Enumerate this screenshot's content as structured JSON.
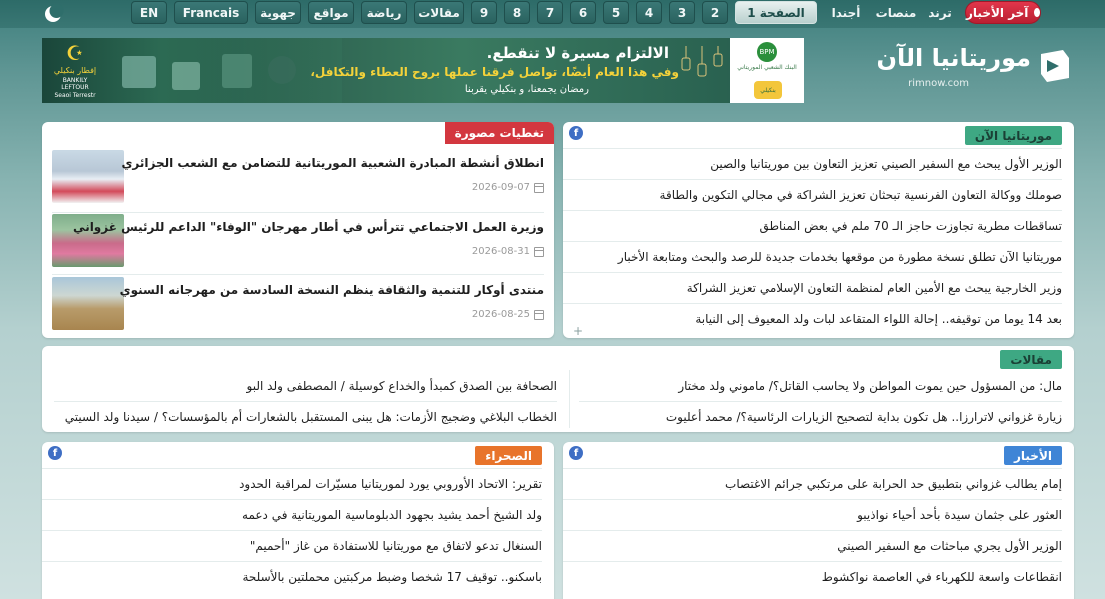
{
  "topnav": {
    "latest_label": "آخر الأخبار",
    "items": [
      "ترند",
      "منصات",
      "أجندا",
      "الصفحة 1",
      "2",
      "3",
      "4",
      "5",
      "6",
      "7",
      "8",
      "9",
      "مقالات",
      "رياضة",
      "مواقع",
      "جهوية",
      "Francais",
      "EN"
    ],
    "active_index": 3,
    "moon_icon": "moon-icon"
  },
  "header": {
    "logo_title": "موريتانيا الآن",
    "logo_url": "rimnow.com"
  },
  "banner": {
    "headline": "الالتزام مسيرة لا تنقطع.",
    "subline": "وفي هذا العام أيضًا، تواصل فرقنا عملها بروح العطاء والتكافل،",
    "tagline": "رمضان يجمعنا، و بنكيلي يقربنا",
    "brand_line1": "إفطار بنكيلي",
    "brand_line2": "BANKILY LEFTOUR",
    "brand_line3": "Seaoi Terrestr",
    "sponsor_text": "البنك الشعبي الموريتاني",
    "sponsor_badge": "بنكيلي"
  },
  "photo_coverage": {
    "tag": "تغطيات مصورة",
    "items": [
      {
        "title": "انطلاق أنشطة المبادرة الشعبية الموريتانية للتضامن مع الشعب الجزائري",
        "date": "2026-09-07"
      },
      {
        "title": "وزيرة العمل الاجتماعي تترأس في أطار مهرجان \"الوفاء\" الداعم للرئيس غزواني",
        "date": "2026-08-31"
      },
      {
        "title": "منتدى أوكار للتنمية والثقافة ينظم النسخة السادسة من مهرجانه السنوي",
        "date": "2026-08-25"
      }
    ]
  },
  "mauritania_now": {
    "tag": "موريتانيا الآن",
    "items": [
      "الوزير الأول يبحث مع السفير الصيني تعزيز التعاون بين موريتانيا والصين",
      "صوملك ووكالة التعاون الفرنسية تبحثان تعزيز الشراكة في مجالي التكوين والطاقة",
      "تساقطات مطرية تجاوزت حاجز الـ 70 ملم في بعض المناطق",
      "موريتانيا الآن تطلق نسخة مطورة من موقعها بخدمات جديدة للرصد والبحث ومتابعة الأخبار",
      "وزير الخارجية يبحث مع الأمين العام لمنظمة التعاون الإسلامي تعزيز الشراكة",
      "بعد 14 يوما من توقيفه.. إحالة اللواء المتقاعد لبات ولد المعيوف إلى النيابة"
    ]
  },
  "articles": {
    "tag": "مقالات",
    "items": [
      "مال: من المسؤول حين يموت المواطن ولا يحاسب القاتل؟/ ماموني ولد مختار",
      "الصحافة بين الصدق كمبدأ والخداع كوسيلة / المصطفى ولد البو",
      "زيارة غزواني لاترارزا.. هل تكون بداية لتصحيح الزيارات الرئاسية؟/ محمد أعليوت",
      "الخطاب البلاغي وضجيج الأزمات: هل يبنى المستقبل بالشعارات أم بالمؤسسات؟ / سيدنا ولد السيتي"
    ]
  },
  "sahara": {
    "tag": "الصحراء",
    "items": [
      "تقرير: الاتحاد الأوروبي يورد لموريتانيا مسيّرات لمراقبة الحدود",
      "ولد الشيخ أحمد يشيد بجهود الدبلوماسية الموريتانية في دعمه",
      "السنغال تدعو لاتفاق مع موريتانيا للاستفادة من غاز \"أحميم\"",
      "باسكنو.. توقيف 17 شخصا وضبط مركبتين محملتين بالأسلحة"
    ]
  },
  "news": {
    "tag": "الأخبار",
    "items": [
      "إمام يطالب غزواني بتطبيق حد الحرابة على مرتكبي جرائم الاغتصاب",
      "العثور على جثمان سيدة بأحد أحياء نواذيبو",
      "الوزير الأول يجري مباحثات مع السفير الصيني",
      "انقطاعات واسعة للكهرباء في العاصمة نواكشوط"
    ]
  },
  "icons": {
    "facebook": "f",
    "plus": "+"
  }
}
